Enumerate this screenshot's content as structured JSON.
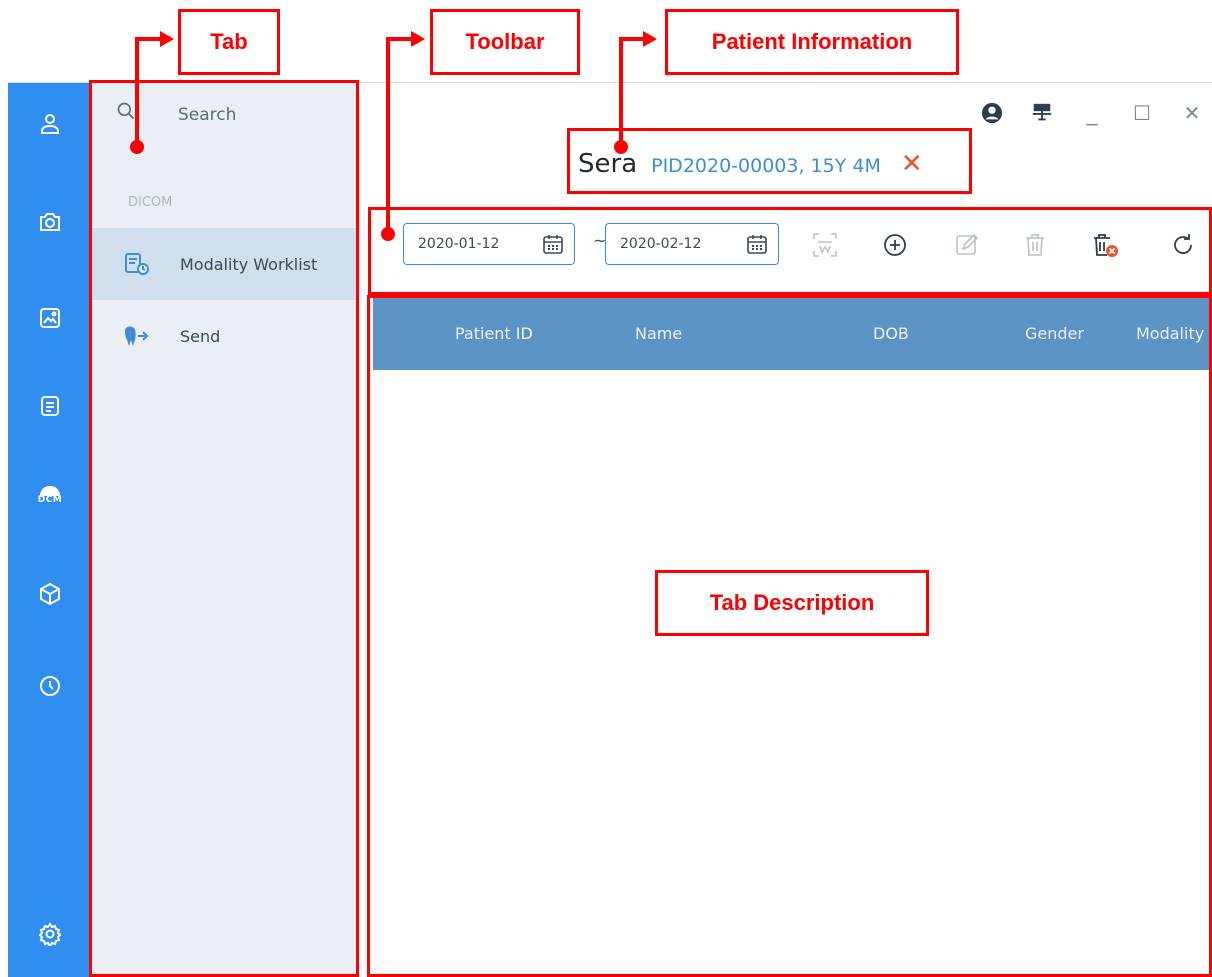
{
  "sidebar": {
    "icons": [
      "user-icon",
      "camera-icon",
      "image-icon",
      "report-icon",
      "dcm-icon",
      "cube-icon",
      "clock-icon",
      "settings-icon"
    ],
    "dcm_label": "DCM"
  },
  "tab_panel": {
    "search_label": "Search",
    "section_label": "DICOM",
    "items": [
      {
        "label": "Modality Worklist",
        "icon": "worklist-icon",
        "active": true
      },
      {
        "label": "Send",
        "icon": "tooth-send-icon",
        "active": false
      }
    ]
  },
  "patient": {
    "name": "Sera",
    "meta": "PID2020-00003, 15Y 4M",
    "close_glyph": "✕"
  },
  "window_controls": {
    "minimize_glyph": "_",
    "maximize_glyph": "☐",
    "close_glyph": "✕"
  },
  "toolbar": {
    "date_from": "2020-01-12",
    "date_to": "2020-02-12",
    "range_separator": "~",
    "tools": [
      "scan-icon",
      "add-icon",
      "edit-icon",
      "delete-icon",
      "delete-all-icon",
      "refresh-icon"
    ]
  },
  "table": {
    "columns": [
      "Patient ID",
      "Name",
      "DOB",
      "Gender",
      "Modality"
    ]
  },
  "annotations": {
    "tab": "Tab",
    "toolbar": "Toolbar",
    "patient_information": "Patient Information",
    "tab_description": "Tab Description"
  },
  "colors": {
    "rail": "#2f8ef0",
    "panel": "#e9eff5",
    "active_item": "#cfdfee",
    "table_header": "#5a93c4",
    "patient_meta": "#3f8fd0",
    "annotation": "#ff0000"
  }
}
